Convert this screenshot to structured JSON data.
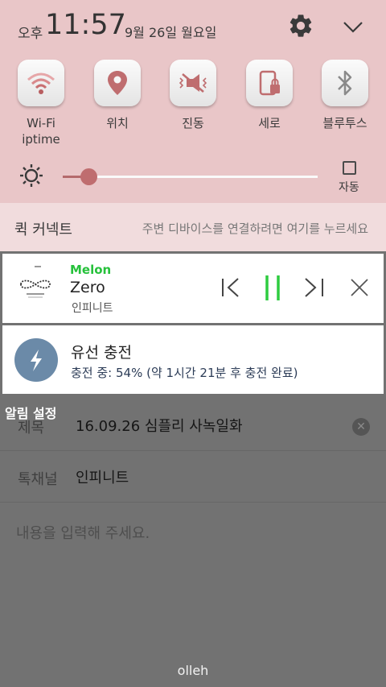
{
  "status": {
    "ampm": "오후",
    "time": "11:57",
    "date": "9월 26일 월요일"
  },
  "header_icons": {
    "settings": "gear-icon",
    "collapse": "chevron-down-icon"
  },
  "quick_settings": [
    {
      "label": "Wi-Fi\niptime",
      "icon": "wifi-icon"
    },
    {
      "label": "위치",
      "icon": "location-pin-icon"
    },
    {
      "label": "진동",
      "icon": "vibrate-icon"
    },
    {
      "label": "세로",
      "icon": "portrait-lock-icon"
    },
    {
      "label": "블루투스",
      "icon": "bluetooth-icon"
    }
  ],
  "brightness": {
    "level": 0.1,
    "auto_label": "자동",
    "auto_checked": false
  },
  "quick_connect": {
    "title": "퀵 커넥트",
    "hint": "주변 디바이스를 연결하려면 여기를 누르세요"
  },
  "music": {
    "app": "Melon",
    "title": "Zero",
    "artist": "인피니트",
    "state": "playing"
  },
  "charging": {
    "title": "유선 충전",
    "detail": "충전 중: 54% (약 1시간 21분 후 충전 완료)",
    "percent": 54
  },
  "background": {
    "alert_label": "알림 설정",
    "rows": [
      {
        "label": "제목",
        "value": "16.09.26  심플리 사녹일화"
      },
      {
        "label": "톡채널",
        "value": "인피니트"
      }
    ],
    "placeholder": "내용을 입력해 주세요.",
    "footer": "olleh"
  },
  "colors": {
    "shade": "#e9c6c8",
    "accent": "#bf6d6f",
    "melon_green": "#26c13b",
    "play_green": "#2ecc40"
  }
}
